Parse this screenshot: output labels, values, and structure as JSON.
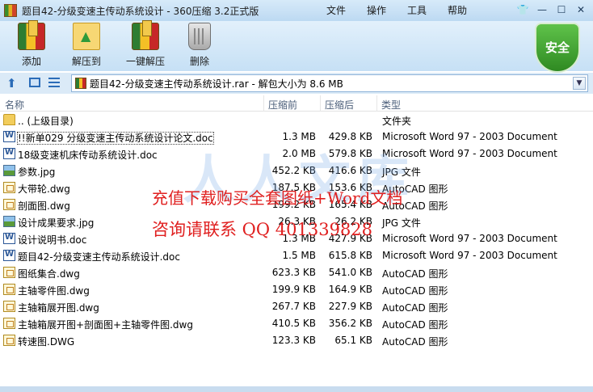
{
  "window": {
    "title": "题目42-分级变速主传动系统设计 - 360压缩 3.2正式版",
    "menu": [
      "文件",
      "操作",
      "工具",
      "帮助"
    ],
    "controls": [
      "shirt-icon",
      "minimize",
      "maximize",
      "close"
    ]
  },
  "toolbar": {
    "add_label": "添加",
    "extract_label": "解压到",
    "oneclick_label": "一键解压",
    "delete_label": "删除",
    "shield_label": "安全"
  },
  "address": {
    "path": "题目42-分级变速主传动系统设计.rar - 解包大小为 8.6 MB"
  },
  "columns": {
    "name": "名称",
    "size": "压缩前",
    "packed": "压缩后",
    "type": "类型"
  },
  "files": [
    {
      "name": ".. (上级目录)",
      "size": "",
      "packed": "",
      "type": "文件夹",
      "icon": "folder-icon"
    },
    {
      "name": "!!新单029 分级变速主传动系统设计论文.doc",
      "size": "1.3 MB",
      "packed": "429.8 KB",
      "type": "Microsoft Word 97 - 2003 Document",
      "icon": "doc-icon"
    },
    {
      "name": "18级变速机床传动系统设计.doc",
      "size": "2.0 MB",
      "packed": "579.8 KB",
      "type": "Microsoft Word 97 - 2003 Document",
      "icon": "doc-icon"
    },
    {
      "name": "参数.jpg",
      "size": "452.2 KB",
      "packed": "416.6 KB",
      "type": "JPG 文件",
      "icon": "jpg-icon"
    },
    {
      "name": "大带轮.dwg",
      "size": "187.5 KB",
      "packed": "153.6 KB",
      "type": "AutoCAD 图形",
      "icon": "dwg-icon"
    },
    {
      "name": "剖面图.dwg",
      "size": "199.2 KB",
      "packed": "165.4 KB",
      "type": "AutoCAD 图形",
      "icon": "dwg-icon"
    },
    {
      "name": "设计成果要求.jpg",
      "size": "26.3 KB",
      "packed": "26.2 KB",
      "type": "JPG 文件",
      "icon": "jpg-icon"
    },
    {
      "name": "设计说明书.doc",
      "size": "1.3 MB",
      "packed": "427.9 KB",
      "type": "Microsoft Word 97 - 2003 Document",
      "icon": "doc-icon"
    },
    {
      "name": "题目42-分级变速主传动系统设计.doc",
      "size": "1.5 MB",
      "packed": "615.8 KB",
      "type": "Microsoft Word 97 - 2003 Document",
      "icon": "doc-icon"
    },
    {
      "name": "图纸集合.dwg",
      "size": "623.3 KB",
      "packed": "541.0 KB",
      "type": "AutoCAD 图形",
      "icon": "dwg-icon"
    },
    {
      "name": "主轴零件图.dwg",
      "size": "199.9 KB",
      "packed": "164.9 KB",
      "type": "AutoCAD 图形",
      "icon": "dwg-icon"
    },
    {
      "name": "主轴箱展开图.dwg",
      "size": "267.7 KB",
      "packed": "227.9 KB",
      "type": "AutoCAD 图形",
      "icon": "dwg-icon"
    },
    {
      "name": "主轴箱展开图+剖面图+主轴零件图.dwg",
      "size": "410.5 KB",
      "packed": "356.2 KB",
      "type": "AutoCAD 图形",
      "icon": "dwg-icon"
    },
    {
      "name": "转速图.DWG",
      "size": "123.3 KB",
      "packed": "65.1 KB",
      "type": "AutoCAD 图形",
      "icon": "dwg-icon"
    }
  ],
  "watermark": {
    "bg": "人人文库",
    "line1": "充值下载购买全套图纸+Word文档",
    "line2": "咨询请联系  QQ 401339828"
  }
}
